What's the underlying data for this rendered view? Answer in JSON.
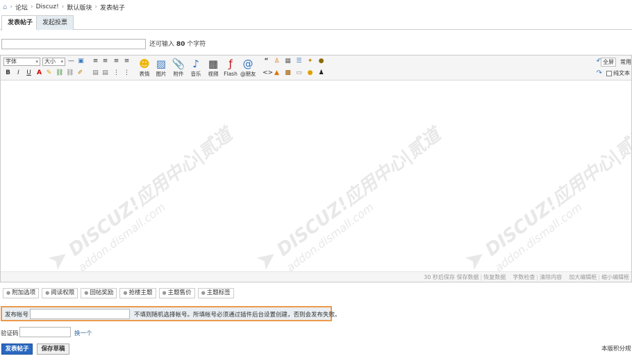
{
  "breadcrumb": {
    "items": [
      "论坛",
      "Discuz!",
      "默认版块",
      "发表帖子"
    ],
    "separator": "›"
  },
  "tabs": [
    {
      "label": "发表帖子",
      "active": true
    },
    {
      "label": "发起投票",
      "active": false
    }
  ],
  "subject": {
    "value": "",
    "hint_prefix": "还可输入",
    "hint_count": "80",
    "hint_suffix": "个字符"
  },
  "toolbar": {
    "font_select": "字体",
    "size_select": "大小",
    "big_buttons": [
      {
        "label": "表情",
        "icon": "smiley-icon"
      },
      {
        "label": "图片",
        "icon": "image-icon"
      },
      {
        "label": "附件",
        "icon": "paperclip-icon"
      },
      {
        "label": "音乐",
        "icon": "music-icon"
      },
      {
        "label": "视频",
        "icon": "video-icon"
      },
      {
        "label": "Flash",
        "icon": "flash-icon"
      },
      {
        "label": "@朋友",
        "icon": "at-icon"
      }
    ],
    "fullscreen": "全屏",
    "common": "常用",
    "plaintext": "纯文本"
  },
  "watermark": {
    "brand": "DISCUZ!应用中心|贰道",
    "site": "addon.dismall.com"
  },
  "statusbar": {
    "autosave": "30 秒后保存",
    "save_data": "保存数据",
    "restore_data": "恢复数据",
    "word_check": "字数检查",
    "clear_content": "清除内容",
    "enlarge": "加大编辑框",
    "shrink": "缩小编辑框"
  },
  "options": [
    "附加选项",
    "阅读权限",
    "回帖奖励",
    "抢楼主题",
    "主题售价",
    "主题标签"
  ],
  "account": {
    "label": "发布帐号",
    "value": "",
    "hint": "不填则随机选择帐号。所填帐号必须通过插件后台设置创建，否则会发布失败。"
  },
  "captcha": {
    "label": "验证码",
    "value": "",
    "refresh": "换一个"
  },
  "buttons": {
    "submit": "发表帖子",
    "save_draft": "保存草稿"
  },
  "credit_rule": "本版积分规"
}
